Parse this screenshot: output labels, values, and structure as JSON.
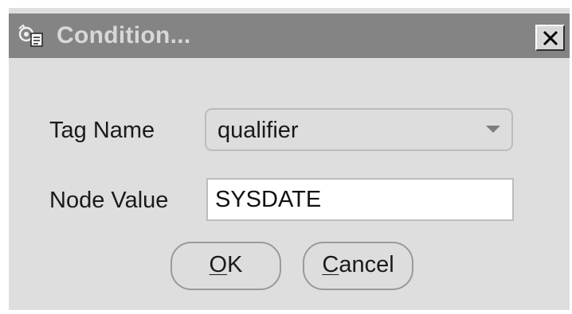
{
  "window": {
    "title": "Condition...",
    "title_icon": "dialog-app-icon",
    "close_icon": "close-x-icon"
  },
  "form": {
    "tag_name_label": "Tag Name",
    "tag_name_value": "qualifier",
    "tag_name_dropdown_icon": "chevron-down-icon",
    "node_value_label": "Node Value",
    "node_value_value": "SYSDATE"
  },
  "buttons": {
    "ok_mnemonic": "O",
    "ok_rest": "K",
    "cancel_mnemonic": "C",
    "cancel_rest": "ancel"
  },
  "colors": {
    "titlebar": "#848484",
    "title_text": "#d8d8d8",
    "dialog_background": "#dedede",
    "input_background": "#ffffff"
  }
}
